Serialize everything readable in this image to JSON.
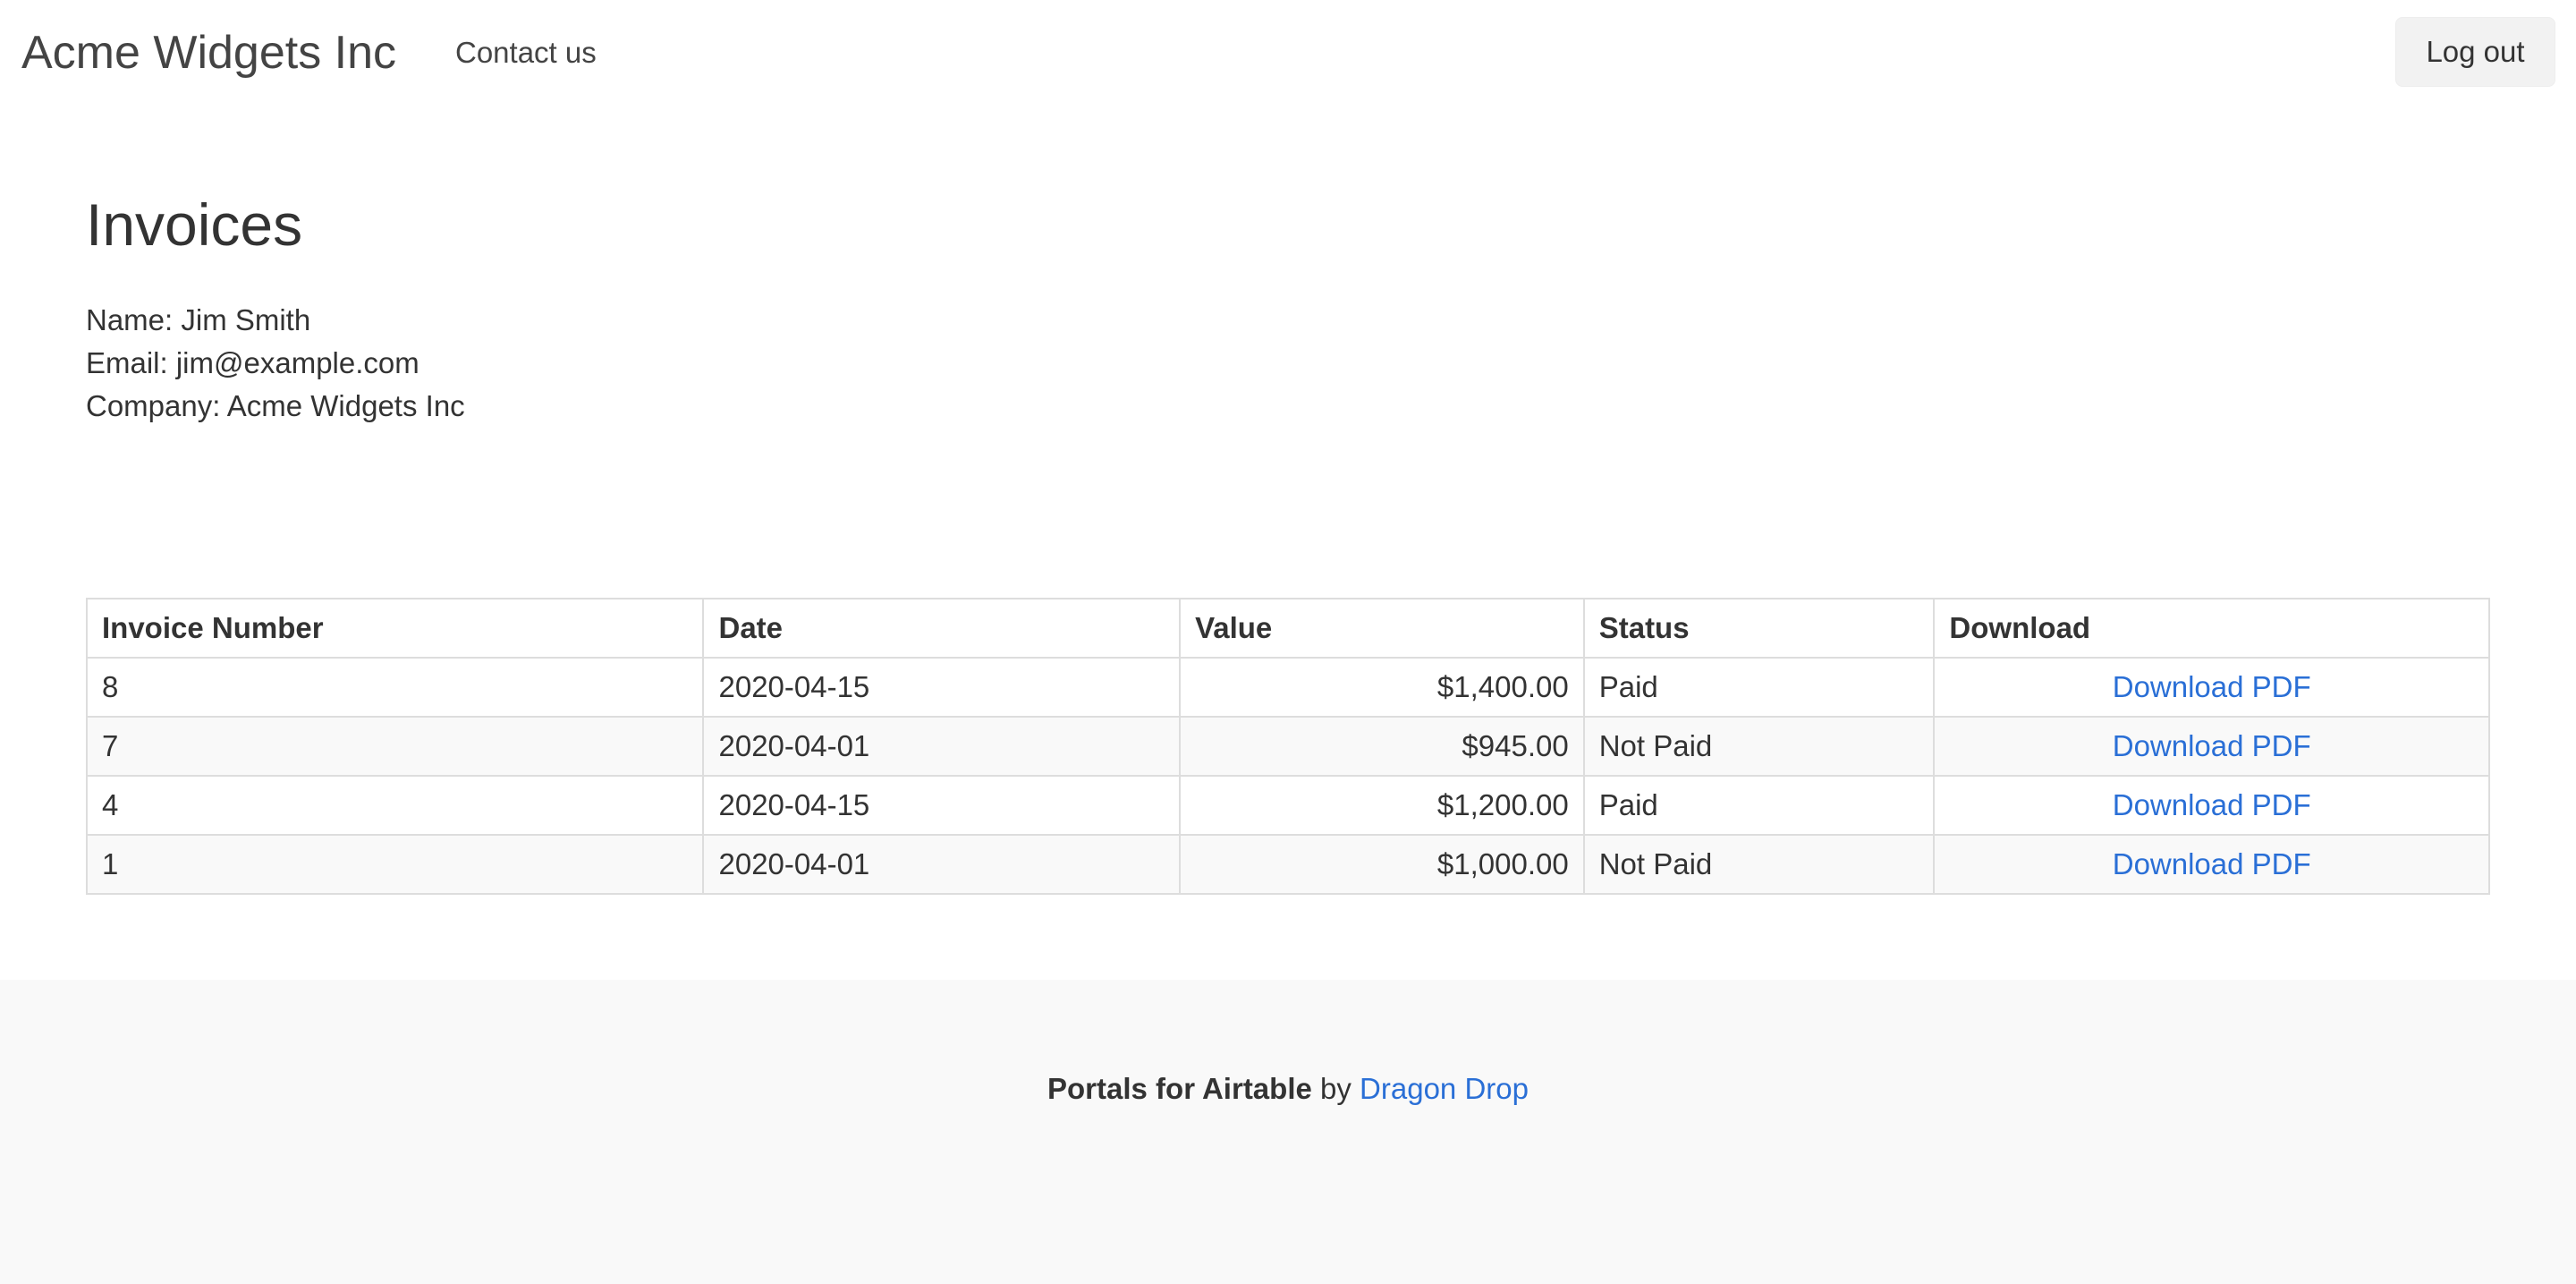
{
  "header": {
    "brand": "Acme Widgets Inc",
    "nav_contact": "Contact us",
    "logout_label": "Log out"
  },
  "page": {
    "title": "Invoices"
  },
  "profile": {
    "name_line": "Name: Jim Smith",
    "email_line": "Email: jim@example.com",
    "company_line": "Company: Acme Widgets Inc"
  },
  "table": {
    "columns": [
      "Invoice Number",
      "Date",
      "Value",
      "Status",
      "Download"
    ],
    "rows": [
      {
        "invoice_number": "8",
        "date": "2020-04-15",
        "value": "$1,400.00",
        "status": "Paid",
        "download": "Download PDF"
      },
      {
        "invoice_number": "7",
        "date": "2020-04-01",
        "value": "$945.00",
        "status": "Not Paid",
        "download": "Download PDF"
      },
      {
        "invoice_number": "4",
        "date": "2020-04-15",
        "value": "$1,200.00",
        "status": "Paid",
        "download": "Download PDF"
      },
      {
        "invoice_number": "1",
        "date": "2020-04-01",
        "value": "$1,000.00",
        "status": "Not Paid",
        "download": "Download PDF"
      }
    ]
  },
  "footer": {
    "product": "Portals for Airtable",
    "by": " by ",
    "company_link": "Dragon Drop"
  },
  "colors": {
    "link": "#2a6fd6",
    "text": "#333333",
    "footer_bg": "#f9f9f9",
    "button_bg": "#f2f2f2"
  }
}
